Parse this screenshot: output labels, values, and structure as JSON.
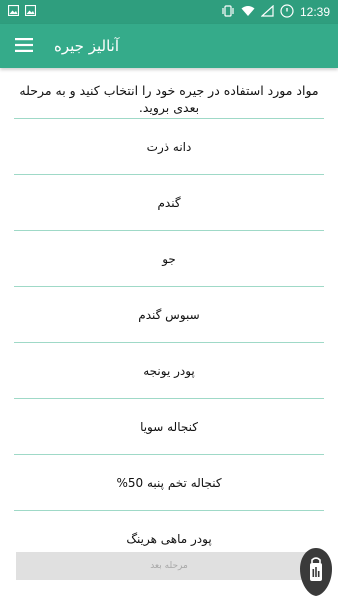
{
  "status_bar": {
    "time": "12:39",
    "left_icons": [
      "image-icon",
      "image-icon"
    ],
    "right_icons": [
      "vibrate-icon",
      "wifi-icon",
      "signal-icon",
      "battery-icon"
    ]
  },
  "app_bar": {
    "title": "آنالیز جیره",
    "menu_icon": "hamburger-menu-icon"
  },
  "instruction": "مواد مورد استفاده در جیره خود را انتخاب کنید و به مرحله بعدی بروید.",
  "items": [
    {
      "label": "دانه ذرت"
    },
    {
      "label": "گندم"
    },
    {
      "label": "جو"
    },
    {
      "label": "سبوس گندم"
    },
    {
      "label": "پودر یونجه"
    },
    {
      "label": "کنجاله سویا"
    },
    {
      "label": "کنجاله تخم پنبه 50%"
    },
    {
      "label": "پودر ماهی هرینگ"
    }
  ],
  "next_button": {
    "label": "مرحله بعد"
  },
  "colors": {
    "status_bar": "#2f9e7e",
    "app_bar": "#35ab8a",
    "divider": "#9fd9c7",
    "button_disabled": "#e0e0e0"
  }
}
